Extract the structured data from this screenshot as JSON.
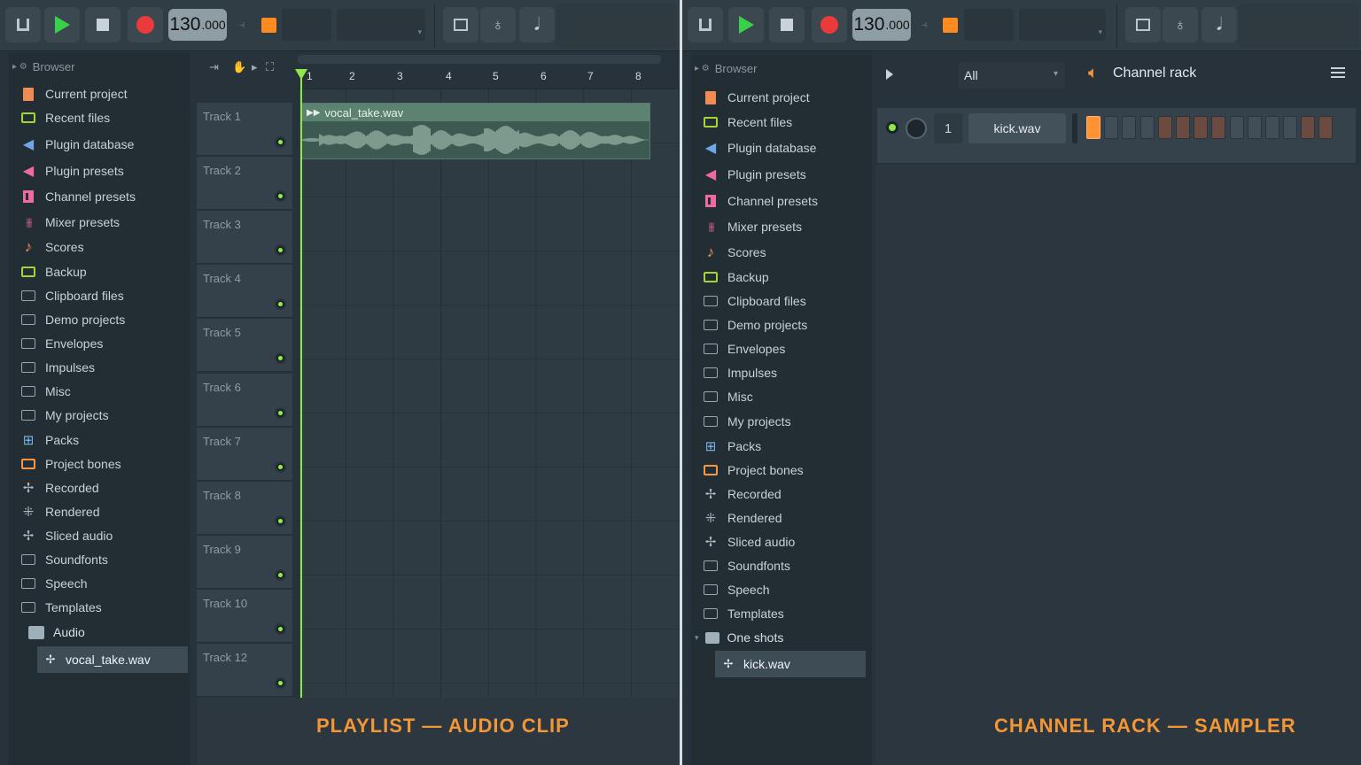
{
  "toolbar": {
    "tempo_main": "130",
    "tempo_frac": ".000"
  },
  "browser": {
    "title": "Browser",
    "items": [
      {
        "label": "Current project",
        "icon": "current-project-icon"
      },
      {
        "label": "Recent files",
        "icon": "recent-files-icon"
      },
      {
        "label": "Plugin database",
        "icon": "plugin-database-icon"
      },
      {
        "label": "Plugin presets",
        "icon": "plugin-presets-icon"
      },
      {
        "label": "Channel presets",
        "icon": "channel-presets-icon"
      },
      {
        "label": "Mixer presets",
        "icon": "mixer-presets-icon"
      },
      {
        "label": "Scores",
        "icon": "scores-icon"
      },
      {
        "label": "Backup",
        "icon": "backup-icon"
      },
      {
        "label": "Clipboard files",
        "icon": "folder-icon"
      },
      {
        "label": "Demo projects",
        "icon": "folder-icon"
      },
      {
        "label": "Envelopes",
        "icon": "folder-icon"
      },
      {
        "label": "Impulses",
        "icon": "folder-icon"
      },
      {
        "label": "Misc",
        "icon": "folder-icon"
      },
      {
        "label": "My projects",
        "icon": "folder-icon"
      },
      {
        "label": "Packs",
        "icon": "packs-icon"
      },
      {
        "label": "Project bones",
        "icon": "project-bones-icon"
      },
      {
        "label": "Recorded",
        "icon": "recorded-icon"
      },
      {
        "label": "Rendered",
        "icon": "rendered-icon"
      },
      {
        "label": "Sliced audio",
        "icon": "sliced-audio-icon"
      },
      {
        "label": "Soundfonts",
        "icon": "folder-icon"
      },
      {
        "label": "Speech",
        "icon": "folder-icon"
      },
      {
        "label": "Templates",
        "icon": "folder-icon"
      }
    ],
    "left_open_folder": "Audio",
    "left_selected_file": "vocal_take.wav",
    "right_open_folder": "One shots",
    "right_selected_file": "kick.wav"
  },
  "playlist": {
    "tracks": [
      "Track 1",
      "Track 2",
      "Track 3",
      "Track 4",
      "Track 5",
      "Track 6",
      "Track 7",
      "Track 8",
      "Track 9",
      "Track 10",
      "Track 12"
    ],
    "bars": [
      "1",
      "2",
      "3",
      "4",
      "5",
      "6",
      "7",
      "8"
    ],
    "clip_name": "vocal_take.wav",
    "caption": "PLAYLIST — AUDIO CLIP"
  },
  "channel_rack": {
    "filter": "All",
    "title": "Channel rack",
    "channel_number": "1",
    "channel_name": "kick.wav",
    "steps": [
      1,
      0,
      0,
      0,
      0,
      0,
      0,
      0,
      0,
      0,
      0,
      0,
      0,
      0
    ],
    "caption": "CHANNEL RACK — SAMPLER"
  },
  "colors": {
    "accent": "#f39636",
    "play": "#39d04a",
    "record": "#ea3a3a",
    "led": "#88ea45"
  }
}
